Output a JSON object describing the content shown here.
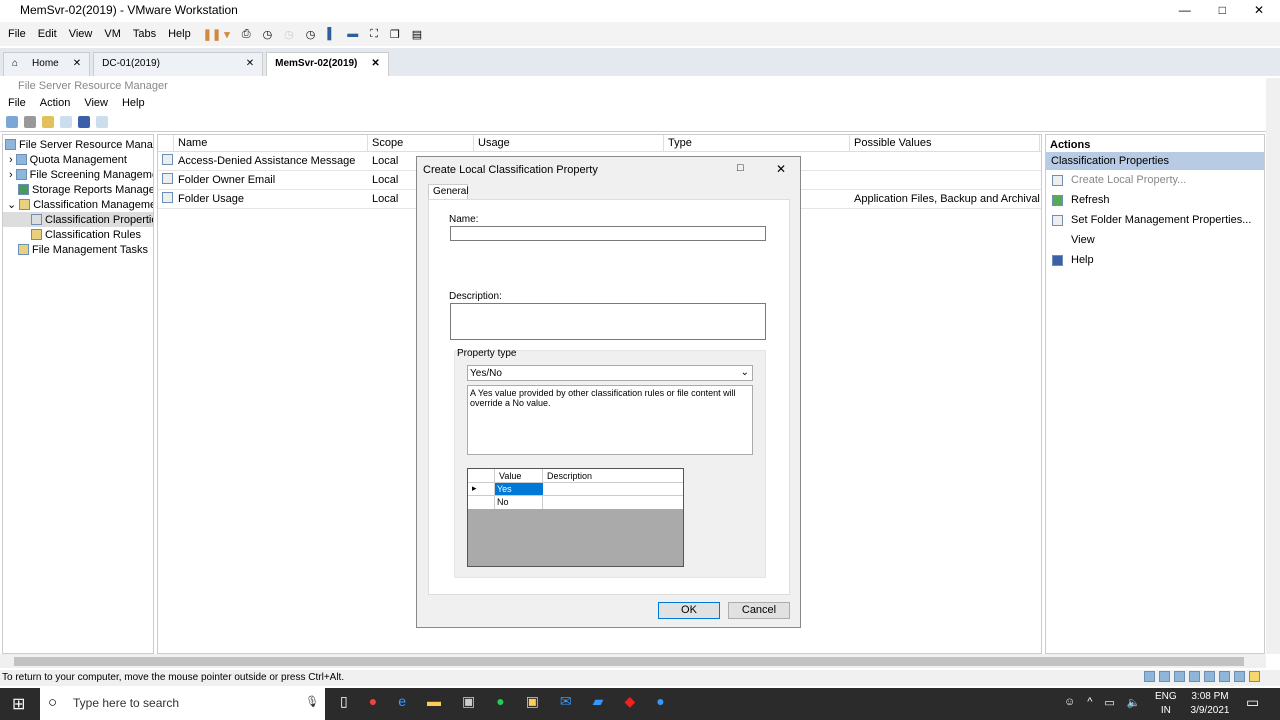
{
  "window": {
    "title": "MemSvr-02(2019) - VMware Workstation",
    "menu": [
      "File",
      "Edit",
      "View",
      "VM",
      "Tabs",
      "Help"
    ],
    "tabs": [
      {
        "label": "Home"
      },
      {
        "label": "DC-01(2019)"
      },
      {
        "label": "MemSvr-02(2019)"
      }
    ]
  },
  "fsrm": {
    "title": "File Server Resource Manager",
    "menu": [
      "File",
      "Action",
      "View",
      "Help"
    ],
    "tree": [
      "File Server Resource Manager",
      "Quota Management",
      "File Screening Management",
      "Storage Reports Management",
      "Classification Management",
      "Classification Properties",
      "Classification Rules",
      "File Management Tasks"
    ],
    "columns": [
      "Name",
      "Scope",
      "Usage",
      "Type",
      "Possible Values"
    ],
    "rows": [
      [
        "Access-Denied Assistance Message",
        "Local",
        "",
        "",
        ""
      ],
      [
        "Folder Owner Email",
        "Local",
        "",
        "",
        ""
      ],
      [
        "Folder Usage",
        "Local",
        "",
        "",
        "Application Files, Backup and Archival Fi..."
      ]
    ],
    "actions": {
      "header": "Actions",
      "section": "Classification Properties",
      "items": [
        "Create Local Property...",
        "Refresh",
        "Set Folder Management Properties...",
        "View",
        "Help"
      ]
    }
  },
  "dialog": {
    "title": "Create Local Classification Property",
    "tab": "General",
    "name_label": "Name:",
    "name_value": "",
    "description_label": "Description:",
    "property_type_label": "Property type",
    "property_type": "Yes/No",
    "type_description": "A Yes value provided by other classification rules or file content will override a No value.",
    "grid_cols": [
      "Value",
      "Description"
    ],
    "grid_rows": [
      [
        "Yes",
        ""
      ],
      [
        "No",
        ""
      ]
    ],
    "ok": "OK",
    "cancel": "Cancel"
  },
  "status": "To return to your computer, move the mouse pointer outside or press Ctrl+Alt.",
  "taskbar": {
    "search_placeholder": "Type here to search",
    "lang1": "ENG",
    "lang2": "IN",
    "time": "3:08 PM",
    "date": "3/9/2021"
  }
}
